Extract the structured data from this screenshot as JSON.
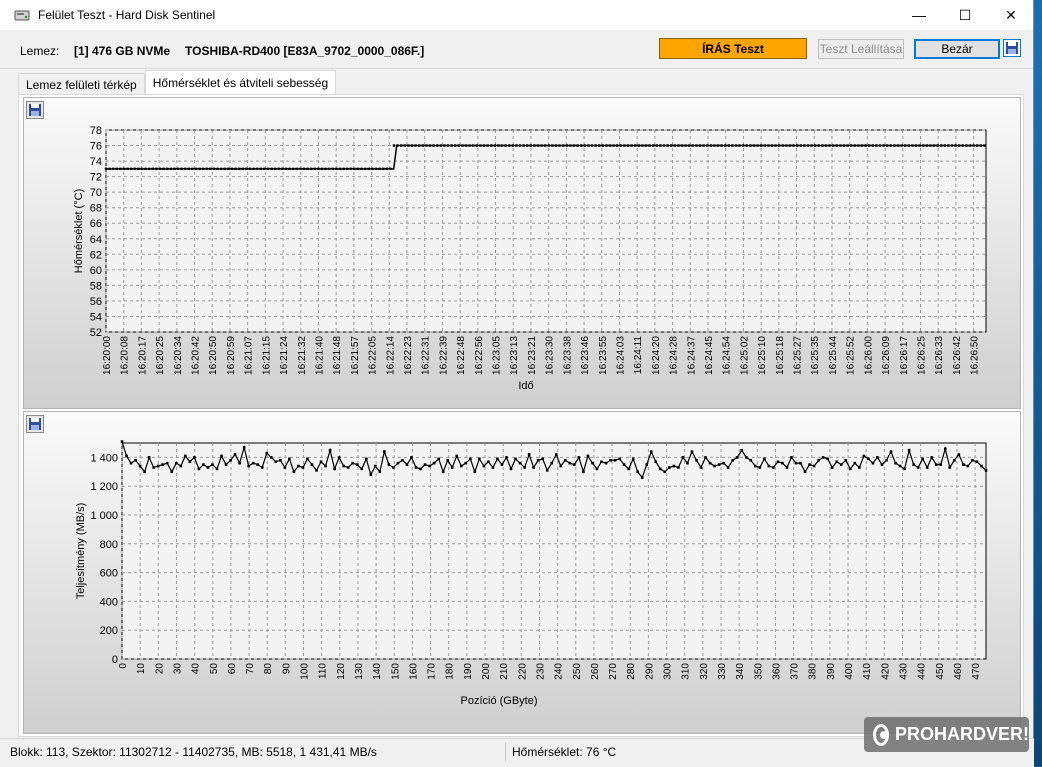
{
  "window": {
    "title": "Felület Teszt - Hard Disk Sentinel",
    "minimize": "—",
    "maximize": "☐",
    "close": "✕"
  },
  "toolbar": {
    "disk_label": "Lemez:",
    "disk_id": "[1] 476 GB  NVMe",
    "disk_name": "TOSHIBA-RD400 [E83A_9702_0000_086F.]",
    "status": "ÍRÁS Teszt",
    "stop_label": "Teszt Leállítása",
    "close_label": "Bezár",
    "status_color": "#ffa500"
  },
  "tabs": [
    {
      "label": "Lemez felületi térkép"
    },
    {
      "label": "Hőmérséklet és átviteli sebesség"
    }
  ],
  "statusbar": {
    "left": "Blokk: 113, Szektor: 11302712 - 11402735, MB: 5518, 1 431,41 MB/s",
    "right": "Hőmérséklet: 76  °C"
  },
  "watermark": "PROHARDVER!",
  "chart_data": [
    {
      "type": "line",
      "xlabel": "Idő",
      "ylabel": "Hőmérséklet (°C)",
      "ylim": [
        52,
        78
      ],
      "yticks": [
        78,
        76,
        74,
        72,
        70,
        68,
        66,
        64,
        62,
        60,
        58,
        56,
        54,
        52
      ],
      "categories": [
        "16:20:00",
        "16:20:08",
        "16:20:17",
        "16:20:25",
        "16:20:34",
        "16:20:42",
        "16:20:50",
        "16:20:59",
        "16:21:07",
        "16:21:15",
        "16:21:24",
        "16:21:32",
        "16:21:40",
        "16:21:48",
        "16:21:57",
        "16:22:05",
        "16:22:14",
        "16:22:23",
        "16:22:31",
        "16:22:39",
        "16:22:48",
        "16:22:56",
        "16:23:05",
        "16:23:13",
        "16:23:21",
        "16:23:30",
        "16:23:38",
        "16:23:46",
        "16:23:55",
        "16:24:03",
        "16:24:11",
        "16:24:20",
        "16:24:28",
        "16:24:37",
        "16:24:45",
        "16:24:54",
        "16:25:02",
        "16:25:10",
        "16:25:18",
        "16:25:27",
        "16:25:35",
        "16:25:44",
        "16:25:52",
        "16:26:00",
        "16:26:09",
        "16:26:17",
        "16:26:25",
        "16:26:33",
        "16:26:42",
        "16:26:50"
      ],
      "series": [
        {
          "values_before": 73,
          "values_after": 76,
          "switch_at": "16:22:14"
        }
      ],
      "grid": true
    },
    {
      "type": "line",
      "xlabel": "Pozíció (GByte)",
      "ylabel": "Teljesítmény (MB/s)",
      "ylim": [
        0,
        1500
      ],
      "yticks": [
        "1 400",
        "1 200",
        "1 000",
        "800",
        "600",
        "400",
        "200",
        "0"
      ],
      "ytick_values": [
        1400,
        1200,
        1000,
        800,
        600,
        400,
        200,
        0
      ],
      "xticks": [
        0,
        10,
        20,
        30,
        40,
        50,
        60,
        70,
        80,
        90,
        100,
        110,
        120,
        130,
        140,
        150,
        160,
        170,
        180,
        190,
        200,
        210,
        220,
        230,
        240,
        250,
        260,
        270,
        280,
        290,
        300,
        310,
        320,
        330,
        340,
        350,
        360,
        370,
        380,
        390,
        400,
        410,
        420,
        430,
        440,
        450,
        460,
        470
      ],
      "xlim": [
        0,
        476
      ],
      "series": [
        {
          "values": [
            1510,
            1410,
            1360,
            1380,
            1340,
            1300,
            1400,
            1330,
            1340,
            1350,
            1360,
            1300,
            1360,
            1340,
            1410,
            1370,
            1400,
            1320,
            1350,
            1330,
            1350,
            1320,
            1410,
            1350,
            1380,
            1420,
            1360,
            1470,
            1340,
            1360,
            1350,
            1330,
            1430,
            1400,
            1370,
            1380,
            1330,
            1390,
            1300,
            1340,
            1330,
            1390,
            1350,
            1310,
            1370,
            1340,
            1450,
            1320,
            1400,
            1340,
            1330,
            1360,
            1350,
            1320,
            1390,
            1280,
            1340,
            1300,
            1440,
            1350,
            1330,
            1360,
            1380,
            1350,
            1400,
            1330,
            1320,
            1350,
            1340,
            1360,
            1390,
            1300,
            1380,
            1330,
            1410,
            1340,
            1360,
            1390,
            1300,
            1390,
            1340,
            1370,
            1330,
            1390,
            1350,
            1400,
            1320,
            1390,
            1360,
            1330,
            1420,
            1330,
            1380,
            1390,
            1310,
            1360,
            1420,
            1340,
            1380,
            1360,
            1350,
            1400,
            1300,
            1410,
            1360,
            1320,
            1370,
            1360,
            1380,
            1380,
            1390,
            1350,
            1320,
            1390,
            1300,
            1260,
            1350,
            1440,
            1370,
            1320,
            1300,
            1330,
            1340,
            1330,
            1400,
            1360,
            1440,
            1380,
            1330,
            1400,
            1360,
            1340,
            1350,
            1360,
            1330,
            1380,
            1400,
            1450,
            1400,
            1380,
            1340,
            1330,
            1390,
            1340,
            1330,
            1370,
            1360,
            1330,
            1400,
            1360,
            1360,
            1300,
            1350,
            1340,
            1380,
            1400,
            1390,
            1330,
            1370,
            1350,
            1380,
            1320,
            1360,
            1330,
            1410,
            1390,
            1360,
            1400,
            1350,
            1380,
            1440,
            1360,
            1340,
            1320,
            1450,
            1350,
            1330,
            1390,
            1330,
            1400,
            1350,
            1350,
            1460,
            1330,
            1380,
            1420,
            1350,
            1340,
            1380,
            1370,
            1340,
            1310
          ]
        }
      ],
      "grid": true
    }
  ]
}
